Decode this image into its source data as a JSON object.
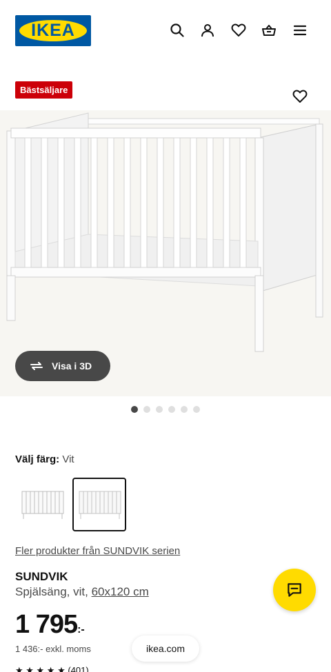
{
  "header": {
    "logo_text": "IKEA",
    "icons": [
      "search-icon",
      "user-icon",
      "heart-icon",
      "basket-icon",
      "menu-icon"
    ]
  },
  "product": {
    "badge": "Bästsäljare",
    "view_3d_label": "Visa i 3D",
    "image_count": 6,
    "active_image": 1,
    "color_label": "Välj färg:",
    "color_value": "Vit",
    "series_link": "Fler produkter från SUNDVIK serien",
    "name": "SUNDVIK",
    "description": "Spjälsäng, vit,",
    "size": "60x120 cm",
    "price_main": "1 795",
    "price_suffix": ":-",
    "price_exkl": "1 436:- exkl. moms",
    "rating_count": "(401)"
  },
  "footer": {
    "url": "ikea.com"
  },
  "colors": {
    "ikea_blue": "#0058a3",
    "ikea_yellow": "#ffdb00",
    "badge_red": "#cc0008",
    "dark_button": "#484848"
  }
}
